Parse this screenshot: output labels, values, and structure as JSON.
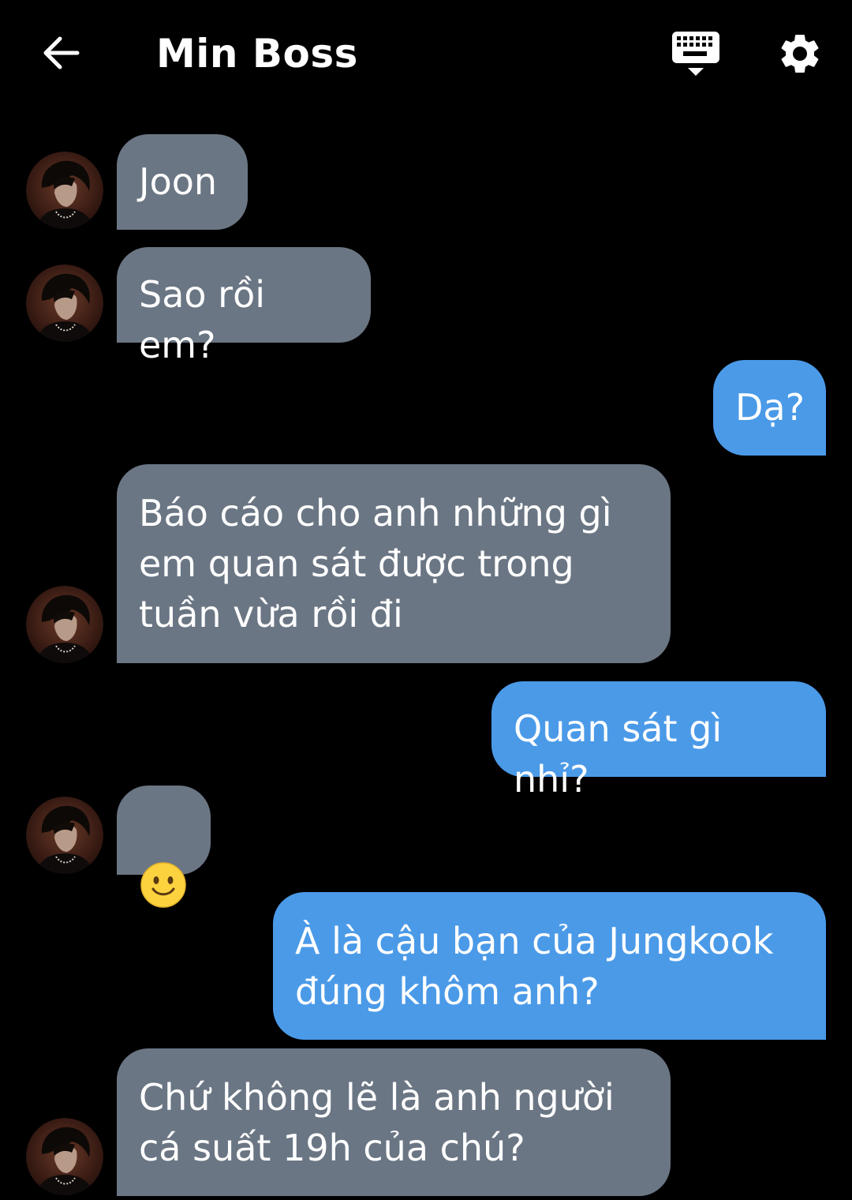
{
  "header": {
    "title": "Min Boss",
    "back_icon": "arrow-left-icon",
    "keyboard_icon": "keyboard-icon",
    "settings_icon": "gear-icon"
  },
  "colors": {
    "background": "#000000",
    "received_bubble": "#6b7684",
    "sent_bubble": "#4b9ae8",
    "text": "#ffffff"
  },
  "messages": [
    {
      "sender": "other",
      "text": "Joon"
    },
    {
      "sender": "other",
      "text": "Sao rồi em?"
    },
    {
      "sender": "me",
      "text": "Dạ?"
    },
    {
      "sender": "other",
      "text": "Báo cáo cho anh những gì\nem quan sát được trong\ntuần vừa rồi đi"
    },
    {
      "sender": "me",
      "text": "Quan sát gì nhỉ?"
    },
    {
      "sender": "other",
      "text": "",
      "emoji": "slightly-smiling-face-emoji"
    },
    {
      "sender": "me",
      "text": "À là cậu bạn của Jungkook\nđúng khôm anh?"
    },
    {
      "sender": "other",
      "text": "Chứ không lẽ là anh người\ncá suất 19h của chú?"
    }
  ]
}
